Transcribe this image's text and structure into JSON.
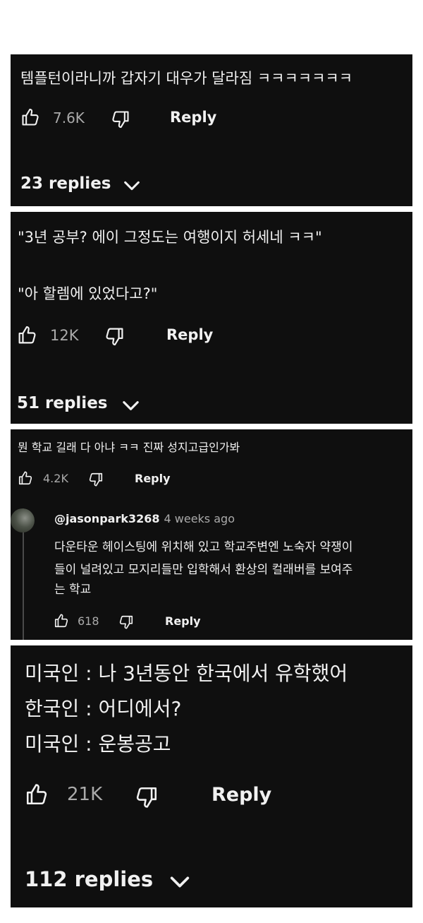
{
  "comments": [
    {
      "text_lines": [
        "템플턴이라니까 갑자기 대우가 달라짐 ㅋㅋㅋㅋㅋㅋㅋ"
      ],
      "likes": "7.6K",
      "reply_label": "Reply",
      "replies_label": "23 replies"
    },
    {
      "text_lines": [
        "\"3년 공부? 에이 그정도는 여행이지 허세네 ㅋㅋ\"",
        "\"아 할렘에 있었다고?\""
      ],
      "likes": "12K",
      "reply_label": "Reply",
      "replies_label": "51 replies"
    },
    {
      "text_lines": [
        "뭔 학교 길래 다 아냐 ㅋㅋ 진짜 성지고급인가봐"
      ],
      "likes": "4.2K",
      "reply_label": "Reply",
      "reply": {
        "handle": "@jasonpark3268",
        "time": "4 weeks ago",
        "text_lines": [
          "다운타운 헤이스팅에 위치해 있고 학교주변엔 노숙자 약쟁이",
          "들이 널려있고 모지리들만 입학해서 환상의 컬래버를 보여주",
          "는 학교"
        ],
        "likes": "618",
        "reply_label": "Reply"
      }
    },
    {
      "text_lines": [
        "미국인 : 나 3년동안 한국에서 유학했어",
        "한국인 : 어디에서?",
        "미국인 : 운봉공고"
      ],
      "likes": "21K",
      "reply_label": "Reply",
      "replies_label": "112 replies"
    }
  ],
  "icons": {
    "like": "thumbs-up-icon",
    "dislike": "thumbs-down-icon",
    "expand": "chevron-down-icon"
  },
  "colors": {
    "panel_bg": "#0f0f0f",
    "text": "#f1f1f1",
    "meta": "#aaaaaa"
  }
}
